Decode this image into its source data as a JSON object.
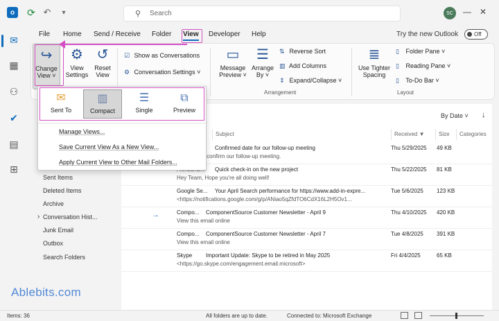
{
  "titlebar": {
    "search_placeholder": "Search",
    "avatar_initials": "SC"
  },
  "menu": {
    "tabs": [
      "File",
      "Home",
      "Send / Receive",
      "Folder",
      "View",
      "Developer",
      "Help"
    ],
    "active_tab": "View",
    "try_label": "Try the new Outlook",
    "toggle_label": "Off"
  },
  "ribbon": {
    "change_view": [
      "Change",
      "View ˅"
    ],
    "view_settings": [
      "View",
      "Settings"
    ],
    "reset_view": [
      "Reset",
      "View"
    ],
    "show_as_conversations": "Show as Conversations",
    "conversation_settings": "Conversation Settings ˅",
    "message_preview": [
      "Message",
      "Preview ˅"
    ],
    "arrange_by": [
      "Arrange",
      "By ˅"
    ],
    "reverse_sort": "Reverse Sort",
    "add_columns": "Add Columns",
    "expand_collapse": "Expand/Collapse ˅",
    "arrangement_label": "Arrangement",
    "use_tighter_spacing": [
      "Use Tighter",
      "Spacing"
    ],
    "folder_pane": "Folder Pane ˅",
    "reading_pane": "Reading Pane ˅",
    "todo_bar": "To-Do Bar ˅",
    "layout_label": "Layout"
  },
  "dropdown": {
    "gallery": [
      {
        "label": "Sent To",
        "icon": "envelope-icon"
      },
      {
        "label": "Compact",
        "icon": "compact-view-icon"
      },
      {
        "label": "Single",
        "icon": "single-view-icon"
      },
      {
        "label": "Preview",
        "icon": "preview-view-icon"
      }
    ],
    "selected": "Compact",
    "items": [
      "Manage Views...",
      "Save Current View As a New View...",
      "Apply Current View to Other Mail Folders..."
    ]
  },
  "folders": [
    "Sent Items",
    "Deleted Items",
    "Archive",
    "Conversation Hist...",
    "Junk Email",
    "Outbox",
    "Search Folders"
  ],
  "brand": "Ablebits.com",
  "list": {
    "sort_label": "By Date ˅",
    "columns": [
      "Subject",
      "Received ▼",
      "Size",
      "Categories"
    ],
    "messages": [
      {
        "from": "",
        "subject": "Confirmed date for our follow-up meeting",
        "preview": "m writing to confirm our follow-up meeting.",
        "date": "Thu 5/29/2025",
        "size": "49 KB"
      },
      {
        "from": "Aleksandr...",
        "subject": "Quick check-in on the new project",
        "preview": "Hey Team,  Hope you're all doing well!",
        "date": "Thu 5/22/2025",
        "size": "81 KB"
      },
      {
        "from": "Google Se...",
        "subject": "Your April Search performance for https://www.add-in-expre...",
        "preview": "<https://notifications.google.com/g/p/ANiao5qZfdTO6CdX16L2H5Ov1...",
        "date": "Tue 5/6/2025",
        "size": "123 KB"
      },
      {
        "from": "Compo...",
        "subject": "ComponentSource Customer Newsletter - April 9",
        "preview": "View this email online",
        "date": "Thu 4/10/2025",
        "size": "420 KB",
        "forwarded": true
      },
      {
        "from": "Compo...",
        "subject": "ComponentSource Customer Newsletter - April 7",
        "preview": "View this email online",
        "date": "Tue 4/8/2025",
        "size": "391 KB"
      },
      {
        "from": "Skype",
        "subject": "Important Update: Skype to be retired in May 2025",
        "preview": "<https://go.skype.com/engagement.email.microsoft>",
        "date": "Fri 4/4/2025",
        "size": "65 KB"
      }
    ]
  },
  "status": {
    "items": "Items: 36",
    "folders_status": "All folders are up to date.",
    "connection": "Connected to: Microsoft Exchange"
  }
}
